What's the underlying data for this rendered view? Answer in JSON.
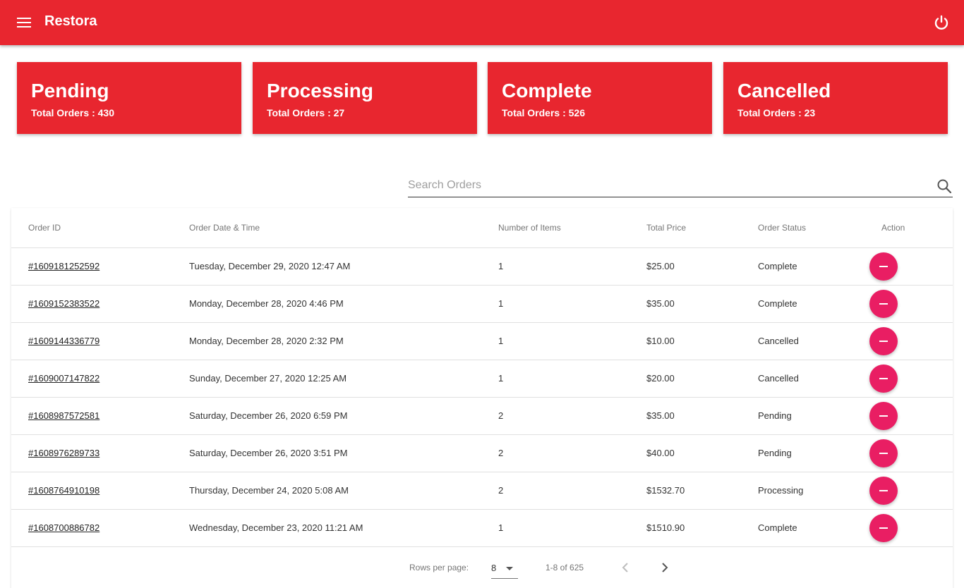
{
  "app": {
    "title": "Restora",
    "accent": "#e8262f",
    "action_color": "#e91e63"
  },
  "header": {
    "menu_icon": "menu-icon",
    "power_icon": "power-icon"
  },
  "summary_cards": [
    {
      "title": "Pending",
      "subtitle": "Total Orders : 430"
    },
    {
      "title": "Processing",
      "subtitle": "Total Orders : 27"
    },
    {
      "title": "Complete",
      "subtitle": "Total Orders : 526"
    },
    {
      "title": "Cancelled",
      "subtitle": "Total Orders : 23"
    }
  ],
  "search": {
    "placeholder": "Search Orders",
    "value": "",
    "icon": "search-icon"
  },
  "table": {
    "columns": [
      "Order ID",
      "Order Date & Time",
      "Number of Items",
      "Total Price",
      "Order Status",
      "Action"
    ],
    "rows": [
      {
        "id": "#1609181252592",
        "datetime": "Tuesday, December 29, 2020 12:47 AM",
        "items": "1",
        "price": "$25.00",
        "status": "Complete"
      },
      {
        "id": "#1609152383522",
        "datetime": "Monday, December 28, 2020 4:46 PM",
        "items": "1",
        "price": "$35.00",
        "status": "Complete"
      },
      {
        "id": "#1609144336779",
        "datetime": "Monday, December 28, 2020 2:32 PM",
        "items": "1",
        "price": "$10.00",
        "status": "Cancelled"
      },
      {
        "id": "#1609007147822",
        "datetime": "Sunday, December 27, 2020 12:25 AM",
        "items": "1",
        "price": "$20.00",
        "status": "Cancelled"
      },
      {
        "id": "#1608987572581",
        "datetime": "Saturday, December 26, 2020 6:59 PM",
        "items": "2",
        "price": "$35.00",
        "status": "Pending"
      },
      {
        "id": "#1608976289733",
        "datetime": "Saturday, December 26, 2020 3:51 PM",
        "items": "2",
        "price": "$40.00",
        "status": "Pending"
      },
      {
        "id": "#1608764910198",
        "datetime": "Thursday, December 24, 2020 5:08 AM",
        "items": "2",
        "price": "$1532.70",
        "status": "Processing"
      },
      {
        "id": "#1608700886782",
        "datetime": "Wednesday, December 23, 2020 11:21 AM",
        "items": "1",
        "price": "$1510.90",
        "status": "Complete"
      }
    ]
  },
  "pagination": {
    "rows_per_page_label": "Rows per page:",
    "rows_per_page_value": "8",
    "range": "1-8 of 625",
    "prev_icon": "chevron-left-icon",
    "next_icon": "chevron-right-icon"
  }
}
